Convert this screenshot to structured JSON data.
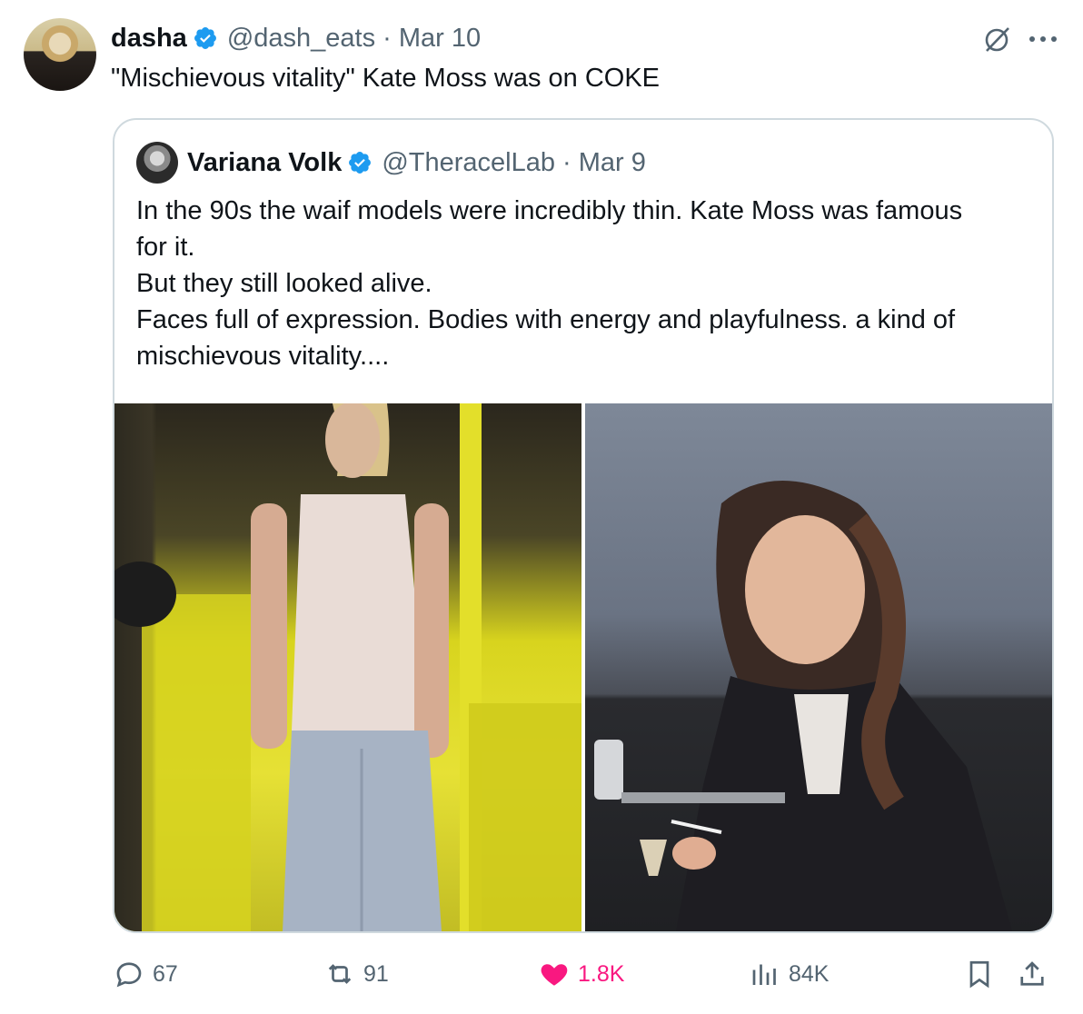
{
  "tweet": {
    "author_name": "dasha",
    "author_handle": "@dash_eats",
    "date": "· Mar 10",
    "text": "\"Mischievous vitality\" Kate Moss was on COKE"
  },
  "quoted": {
    "author_name": "Variana Volk",
    "author_handle": "@TheracelLab",
    "date": "· Mar 9",
    "lines": [
      "In the 90s the waif models were incredibly thin. Kate Moss was famous",
      "for it.",
      "But they still looked alive.",
      "Faces full of expression. Bodies with energy and playfulness. a kind of",
      "mischievous vitality...."
    ]
  },
  "actions": {
    "replies": "67",
    "reposts": "91",
    "likes": "1.8K",
    "views": "84K"
  },
  "icons": {
    "verified": "verified-badge-icon",
    "grok": "slashed-circle-icon",
    "more": "more-dots-icon",
    "reply": "reply-bubble-icon",
    "repost": "repost-icon",
    "like": "heart-icon",
    "views": "views-bar-chart-icon",
    "bookmark": "bookmark-icon",
    "share": "share-upload-icon"
  },
  "colors": {
    "verified": "#1d9bf0",
    "like": "#f91880",
    "muted": "#536471",
    "border": "#cfd9de"
  }
}
